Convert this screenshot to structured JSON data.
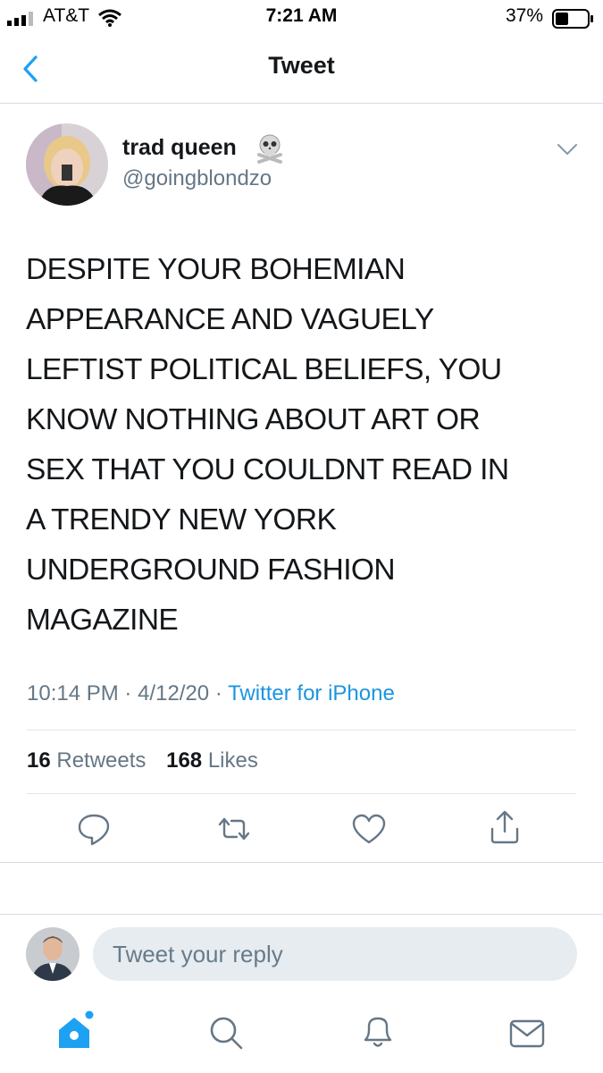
{
  "status_bar": {
    "carrier": "AT&T",
    "time": "7:21 AM",
    "battery": "37%"
  },
  "nav": {
    "title": "Tweet"
  },
  "author": {
    "name": "trad queen",
    "handle": "@goingblondzo",
    "badge_icon": "skull-crossbones-icon"
  },
  "tweet": {
    "lines": [
      "DESPITE YOUR BOHEMIAN",
      "APPEARANCE AND VAGUELY",
      "LEFTIST POLITICAL BELIEFS, YOU",
      "KNOW NOTHING ABOUT ART OR",
      "SEX THAT YOU COULDNT READ IN",
      "A TRENDY NEW YORK",
      "UNDERGROUND FASHION",
      "MAGAZINE"
    ],
    "time": "10:14 PM",
    "date": "4/12/20",
    "separator": "·",
    "source": "Twitter for iPhone"
  },
  "stats": {
    "retweets_count": "16",
    "retweets_label": "Retweets",
    "likes_count": "168",
    "likes_label": "Likes"
  },
  "actions": [
    "reply-icon",
    "retweet-icon",
    "like-icon",
    "share-icon"
  ],
  "reply": {
    "placeholder": "Tweet your reply"
  },
  "tab_bar": [
    "home-icon",
    "search-icon",
    "notifications-icon",
    "messages-icon"
  ],
  "colors": {
    "accent": "#1da1f2",
    "link": "#1b95e0",
    "secondary_text": "#657786",
    "divider": "#e1e8ed"
  }
}
